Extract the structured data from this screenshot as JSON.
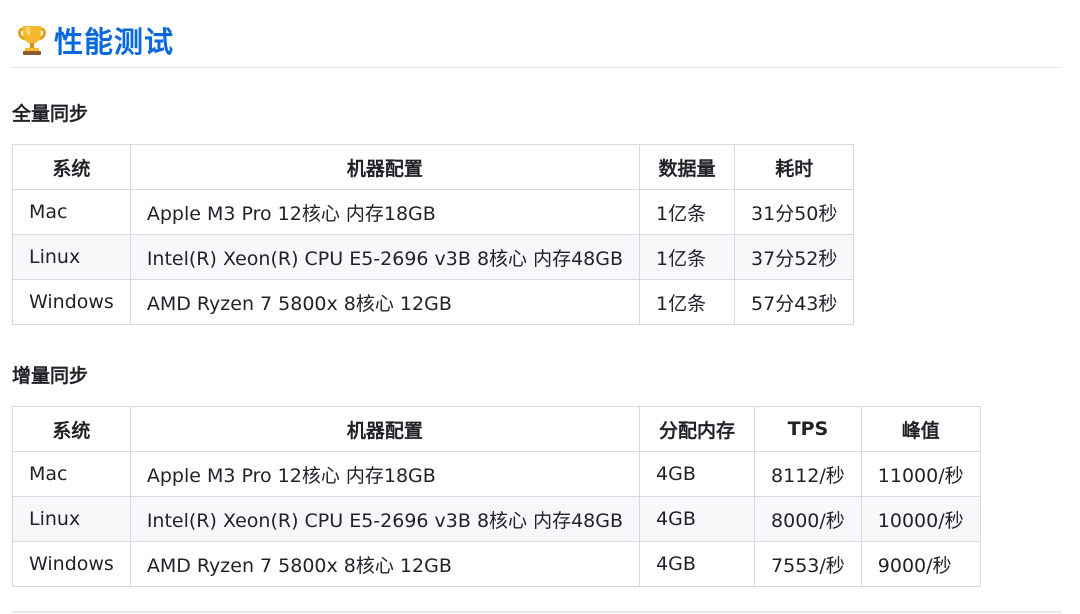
{
  "heading": {
    "icon": "trophy-icon",
    "title": "性能测试",
    "title_color": "#0969da"
  },
  "full_sync": {
    "title": "全量同步",
    "headers": [
      "系统",
      "机器配置",
      "数据量",
      "耗时"
    ],
    "rows": [
      [
        "Mac",
        "Apple M3 Pro 12核心 内存18GB",
        "1亿条",
        "31分50秒"
      ],
      [
        "Linux",
        "Intel(R) Xeon(R) CPU E5-2696 v3B 8核心 内存48GB",
        "1亿条",
        "37分52秒"
      ],
      [
        "Windows",
        "AMD Ryzen 7 5800x 8核心 12GB",
        "1亿条",
        "57分43秒"
      ]
    ]
  },
  "incremental_sync": {
    "title": "增量同步",
    "headers": [
      "系统",
      "机器配置",
      "分配内存",
      "TPS",
      "峰值"
    ],
    "rows": [
      [
        "Mac",
        "Apple M3 Pro 12核心 内存18GB",
        "4GB",
        "8112/秒",
        "11000/秒"
      ],
      [
        "Linux",
        "Intel(R) Xeon(R) CPU E5-2696 v3B 8核心 内存48GB",
        "4GB",
        "8000/秒",
        "10000/秒"
      ],
      [
        "Windows",
        "AMD Ryzen 7 5800x 8核心 12GB",
        "4GB",
        "7553/秒",
        "9000/秒"
      ]
    ]
  }
}
